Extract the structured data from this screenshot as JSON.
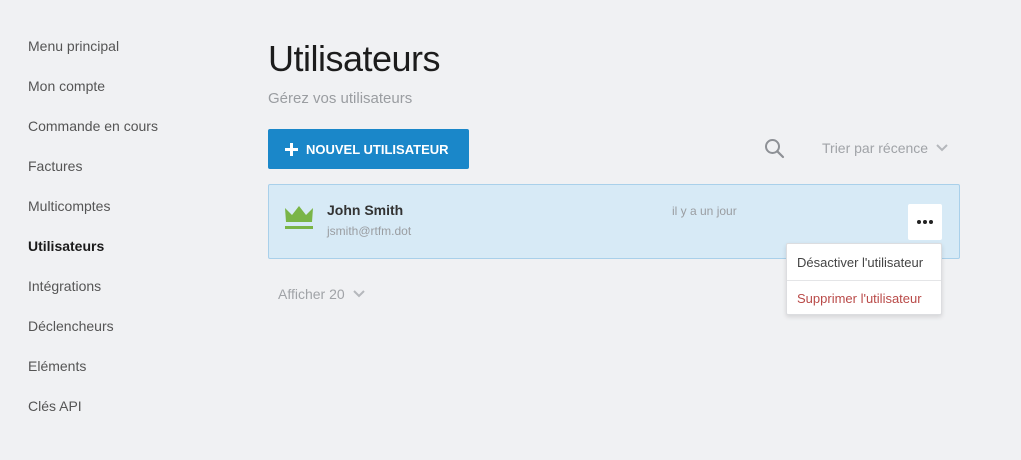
{
  "sidebar": {
    "items": [
      {
        "label": "Menu principal"
      },
      {
        "label": "Mon compte"
      },
      {
        "label": "Commande en cours"
      },
      {
        "label": "Factures"
      },
      {
        "label": "Multicomptes"
      },
      {
        "label": "Utilisateurs",
        "active": true
      },
      {
        "label": "Intégrations"
      },
      {
        "label": "Déclencheurs"
      },
      {
        "label": "Eléments"
      },
      {
        "label": "Clés API"
      }
    ]
  },
  "header": {
    "title": "Utilisateurs",
    "subtitle": "Gérez vos utilisateurs"
  },
  "toolbar": {
    "new_user_label": "NOUVEL UTILISATEUR",
    "search_icon": "search-icon",
    "sort_label": "Trier par récence"
  },
  "users": [
    {
      "name": "John Smith",
      "email": "jsmith@rtfm.dot",
      "last_seen": "il y a un jour",
      "icon": "crown-icon"
    }
  ],
  "user_menu": {
    "deactivate_label": "Désactiver l'utilisateur",
    "delete_label": "Supprimer l'utilisateur"
  },
  "pagination": {
    "page_size_label": "Afficher 20"
  },
  "colors": {
    "accent": "#1a87c9",
    "crown": "#7ab547",
    "selected_row": "#d7eaf6",
    "danger": "#b94a48",
    "background": "#f0f1f3"
  }
}
